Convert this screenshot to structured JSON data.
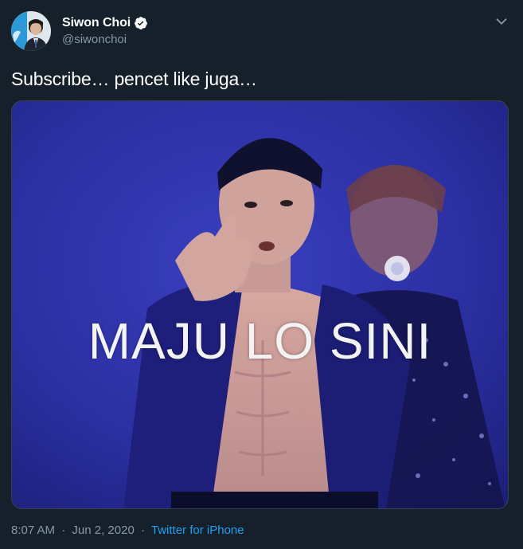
{
  "tweet": {
    "display_name": "Siwon Choi",
    "handle": "@siwonchoi",
    "verified": true,
    "text": "Subscribe… pencet like juga…",
    "media_caption": "MAJU LO SINI",
    "time": "8:07 AM",
    "separator": "·",
    "date": "Jun 2, 2020",
    "source": "Twitter for iPhone"
  },
  "icons": {
    "verified": "verified-badge-icon",
    "menu": "chevron-down-icon"
  },
  "colors": {
    "background": "#15202b",
    "text": "#ffffff",
    "secondary_text": "#8899a6",
    "accent": "#1da1f2",
    "border": "#38444d"
  }
}
